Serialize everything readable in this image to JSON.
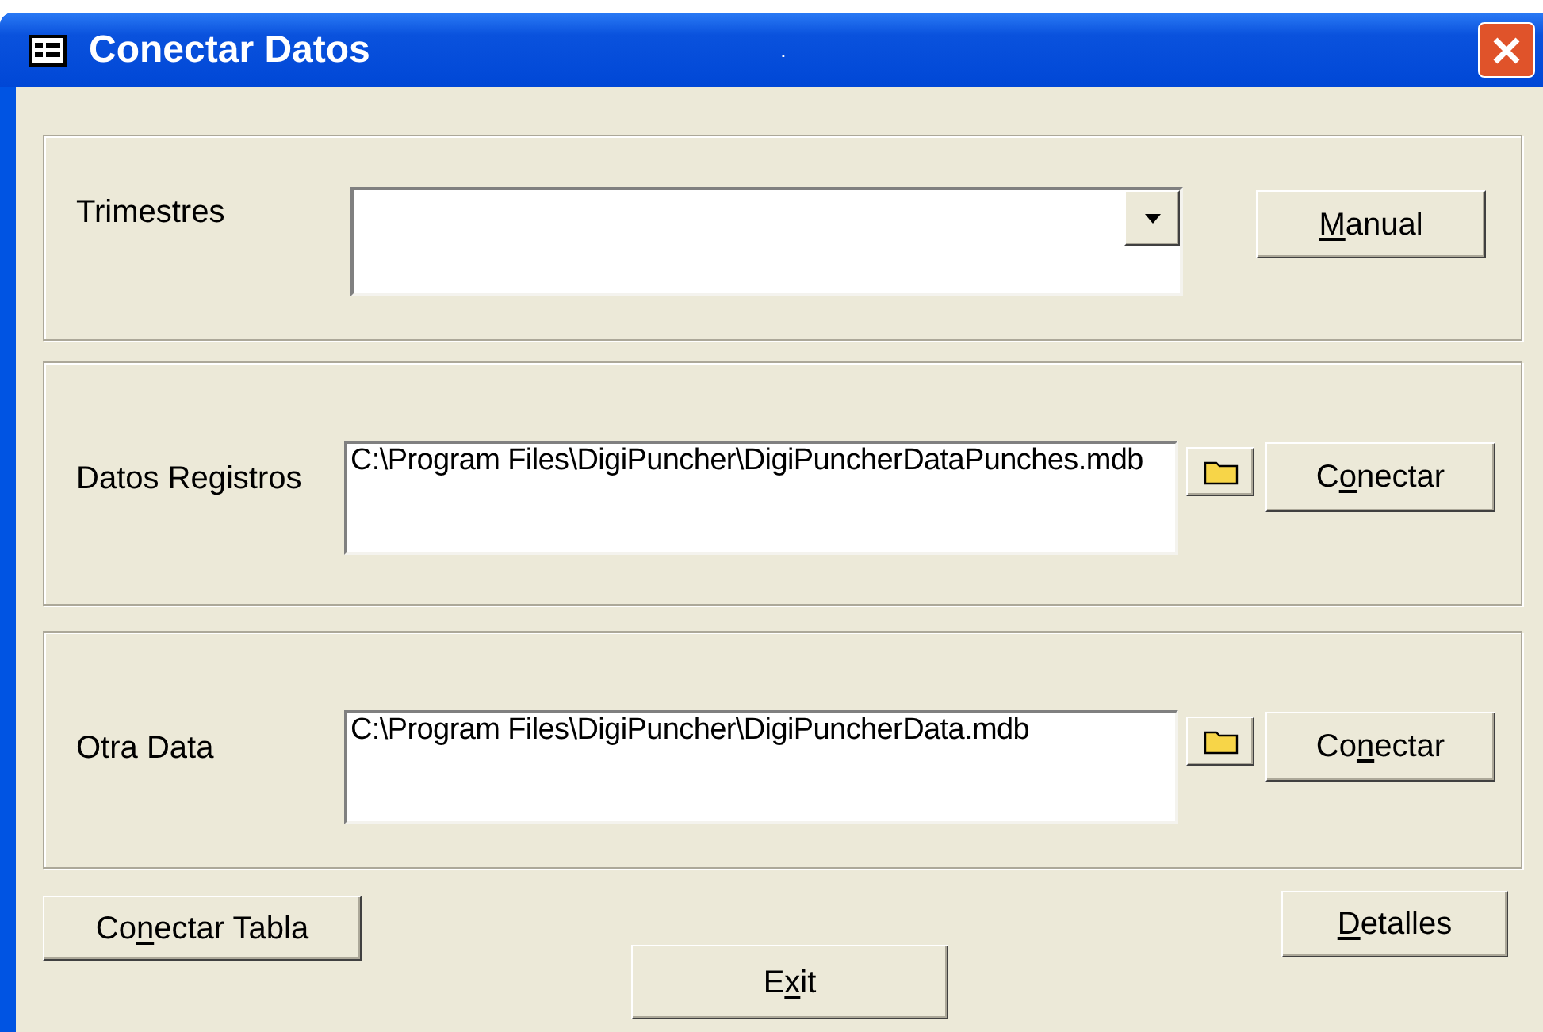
{
  "window": {
    "title": "Conectar Datos",
    "title_mark": "."
  },
  "sections": [
    {
      "kind": "combo",
      "label": "Trimestres",
      "button": {
        "key": "M",
        "after": "anual"
      }
    },
    {
      "kind": "path",
      "label": "Datos Registros",
      "value": "C:\\Program Files\\DigiPuncher\\DigiPuncherDataPunches.mdb",
      "button": {
        "before": "C",
        "key": "o",
        "after": "nectar"
      }
    },
    {
      "kind": "path",
      "label": "Otra Data",
      "value": "C:\\Program Files\\DigiPuncher\\DigiPuncherData.mdb",
      "button": {
        "before": "Co",
        "key": "n",
        "after": "ectar"
      }
    }
  ],
  "footer_buttons": [
    {
      "before": "Co",
      "key": "n",
      "after": "ectar Tabla"
    },
    {
      "before": "E",
      "key": "x",
      "after": "it"
    },
    {
      "key": "D",
      "after": "etalles"
    }
  ]
}
